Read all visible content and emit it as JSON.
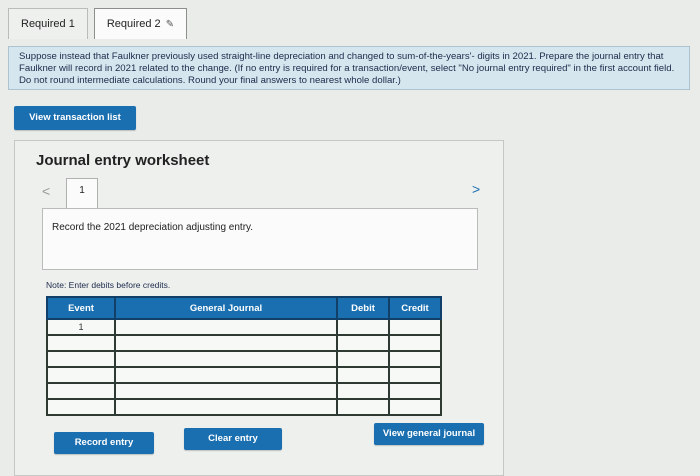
{
  "tabs": [
    {
      "label": "Required 1"
    },
    {
      "label": "Required 2"
    }
  ],
  "instructions": {
    "text": "Suppose instead that Faulkner previously used straight-line depreciation and changed to sum-of-the-years'- digits in 2021. Prepare the journal entry that Faulkner will record in 2021 related to the change. (If no entry is required for a transaction/event, select \"No journal entry required\" in the first account field. Do not round intermediate calculations. Round your final answers to nearest whole dollar.)"
  },
  "buttons": {
    "view_transaction_list": "View transaction list",
    "record_entry": "Record entry",
    "clear_entry": "Clear entry",
    "view_general_journal": "View general journal"
  },
  "worksheet": {
    "title": "Journal entry worksheet",
    "page_number": "1",
    "prompt": "Record the 2021 depreciation adjusting entry.",
    "note": "Note: Enter debits before credits."
  },
  "journal": {
    "headers": {
      "event": "Event",
      "general_journal": "General Journal",
      "debit": "Debit",
      "credit": "Credit"
    },
    "rows": [
      {
        "event": "1"
      },
      {
        "event": ""
      },
      {
        "event": ""
      },
      {
        "event": ""
      },
      {
        "event": ""
      },
      {
        "event": ""
      }
    ]
  },
  "colors": {
    "accent": "#1a6fb0",
    "instruction_bg": "#d5e6ee"
  }
}
